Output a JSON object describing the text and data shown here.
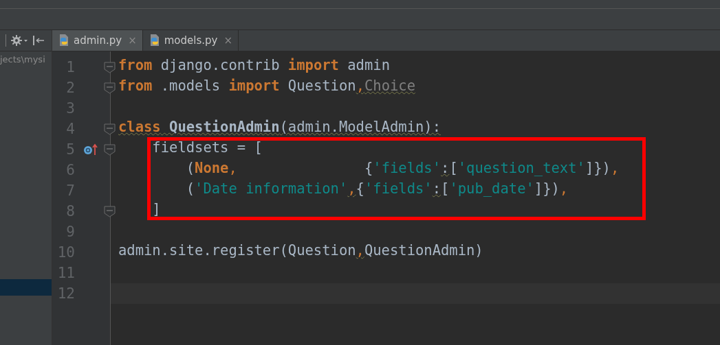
{
  "project_panel": {
    "path": "jects\\mysi",
    "selected_row": true
  },
  "tabs": [
    {
      "label": "admin.py",
      "selected": true,
      "close": "×"
    },
    {
      "label": "models.py",
      "selected": false,
      "close": "×"
    }
  ],
  "editor": {
    "lines": [
      {
        "number": "1",
        "fold": true,
        "marker": false,
        "current": false,
        "tokens": [
          {
            "text": "from",
            "kind": "keyword"
          },
          {
            "text": " django.contrib ",
            "kind": "plain"
          },
          {
            "text": "import",
            "kind": "keyword"
          },
          {
            "text": " admin",
            "kind": "plain"
          }
        ]
      },
      {
        "number": "2",
        "fold": true,
        "marker": false,
        "current": false,
        "tokens": [
          {
            "text": "from",
            "kind": "keyword"
          },
          {
            "text": " .models ",
            "kind": "plain"
          },
          {
            "text": "import",
            "kind": "keyword"
          },
          {
            "text": " Question",
            "kind": "plain"
          },
          {
            "text": ",",
            "kind": "comma_warn"
          },
          {
            "text": "Choice",
            "kind": "unused"
          }
        ]
      },
      {
        "number": "3",
        "fold": false,
        "marker": false,
        "current": false
      },
      {
        "number": "4",
        "fold": true,
        "marker": false,
        "current": false,
        "tokens": [
          {
            "text": "class",
            "kind": "keyword_warn"
          },
          {
            "text": " QuestionAdmin",
            "kind": "name_warn"
          },
          {
            "text": "(admin.ModelAdmin):",
            "kind": "warn"
          }
        ]
      },
      {
        "number": "5",
        "fold": true,
        "marker": true,
        "current": false,
        "tokens": [
          {
            "text": "    fieldsets = [",
            "kind": "plain"
          }
        ]
      },
      {
        "number": "6",
        "fold": false,
        "marker": false,
        "current": false,
        "tokens": [
          {
            "text": "        (",
            "kind": "plain"
          },
          {
            "text": "None",
            "kind": "keyword"
          },
          {
            "text": ",",
            "kind": "comma"
          },
          {
            "text": "               {",
            "kind": "plain"
          },
          {
            "text": "'fields'",
            "kind": "string"
          },
          {
            "text": ":",
            "kind": "warn"
          },
          {
            "text": "[",
            "kind": "plain"
          },
          {
            "text": "'question_text'",
            "kind": "string"
          },
          {
            "text": "]})",
            "kind": "plain"
          },
          {
            "text": ",",
            "kind": "comma"
          }
        ]
      },
      {
        "number": "7",
        "fold": false,
        "marker": false,
        "current": false,
        "tokens": [
          {
            "text": "        (",
            "kind": "plain"
          },
          {
            "text": "'Date information'",
            "kind": "string"
          },
          {
            "text": ",",
            "kind": "comma_warn"
          },
          {
            "text": "{",
            "kind": "plain"
          },
          {
            "text": "'fields'",
            "kind": "string"
          },
          {
            "text": ":",
            "kind": "warn"
          },
          {
            "text": "[",
            "kind": "plain"
          },
          {
            "text": "'pub_date'",
            "kind": "string"
          },
          {
            "text": "]})",
            "kind": "plain"
          },
          {
            "text": ",",
            "kind": "comma"
          }
        ]
      },
      {
        "number": "8",
        "fold": true,
        "marker": false,
        "current": false,
        "tokens": [
          {
            "text": "    ]",
            "kind": "plain"
          }
        ]
      },
      {
        "number": "9",
        "fold": false,
        "marker": false,
        "current": false
      },
      {
        "number": "10",
        "fold": false,
        "marker": false,
        "current": false,
        "tokens": [
          {
            "text": "admin.site.register(Question",
            "kind": "plain"
          },
          {
            "text": ",",
            "kind": "comma_warn"
          },
          {
            "text": "QuestionAdmin)",
            "kind": "plain"
          }
        ]
      },
      {
        "number": "11",
        "fold": false,
        "marker": false,
        "current": false
      },
      {
        "number": "12",
        "fold": false,
        "marker": false,
        "current": true
      }
    ]
  }
}
